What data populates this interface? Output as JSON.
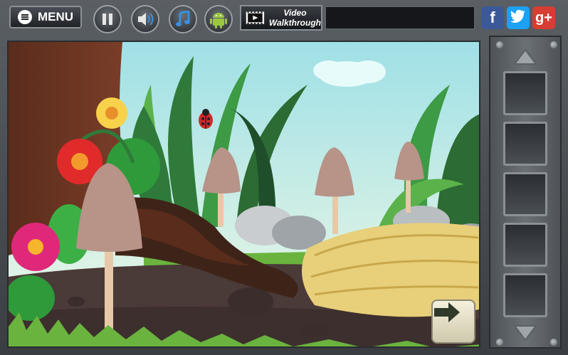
{
  "topbar": {
    "menu_label": "MENU",
    "video_label_line1": "Video",
    "video_label_line2": "Walkthrough",
    "buttons": [
      "pause-icon",
      "speaker-icon",
      "music-note-icon",
      "android-icon"
    ],
    "social": [
      {
        "name": "facebook",
        "glyph": "f",
        "color": "#3b5998"
      },
      {
        "name": "twitter",
        "glyph": "t",
        "color": "#1da1f2"
      },
      {
        "name": "googleplus",
        "glyph": "g+",
        "color": "#d73d32"
      }
    ]
  },
  "inventory": {
    "slot_count": 5,
    "up_icon": "chevron-up-icon",
    "down_icon": "chevron-down-icon"
  },
  "scene": {
    "description_icons": [
      "tree-trunk",
      "ladybug",
      "mushroom",
      "hay-bale",
      "flowers",
      "rocks"
    ],
    "next_icon": "arrow-right-icon",
    "colors": {
      "sky": "#c6ecec",
      "ground": "#4a3a38",
      "grass": "#6ab33e",
      "hay": "#e8cf7a"
    }
  }
}
